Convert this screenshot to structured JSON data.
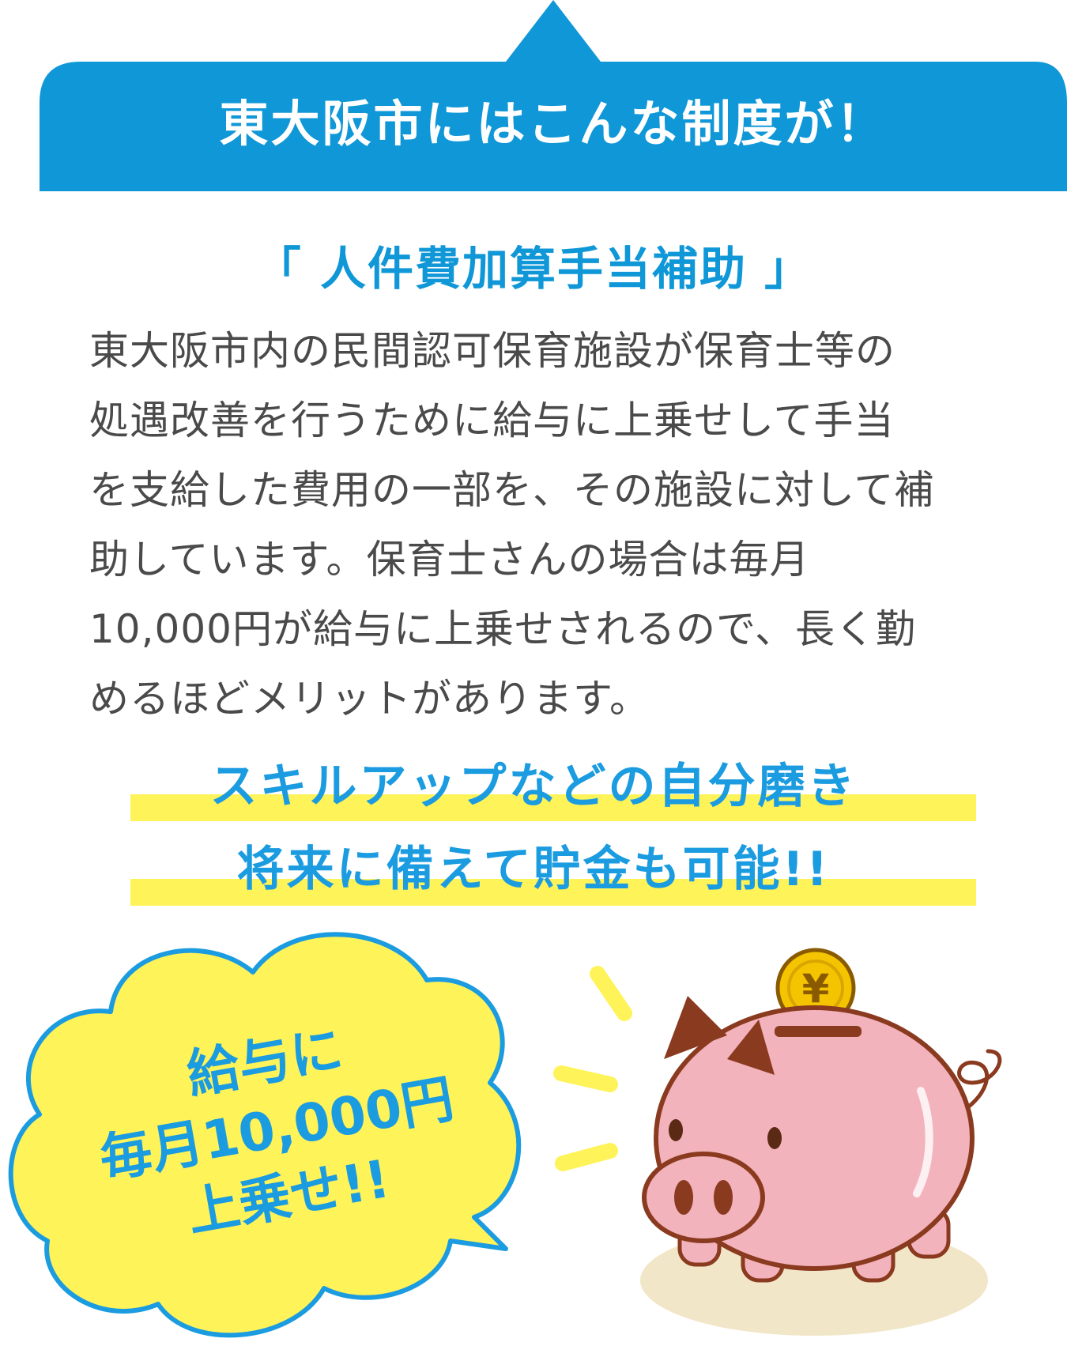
{
  "header": {
    "title": "東大阪市にはこんな制度が！"
  },
  "subsidy": {
    "title": "「 人件費加算手当補助 」"
  },
  "body": {
    "text": "東大阪市内の民間認可保育施設が保育士等の\n処遇改善を行うために給与に上乗せして手当\nを支給した費用の一部を、その施設に対して補\n助しています。保育士さんの場合は毎月\n10,000円が給与に上乗せされるので、長く勤\nめるほどメリットがあります。"
  },
  "highlights": [
    {
      "text": "スキルアップなどの自分磨き"
    },
    {
      "text": "将来に備えて貯金も可能!!"
    }
  ],
  "bubble": {
    "lines": [
      "給与に",
      "毎月10,000円",
      "上乗せ!!"
    ]
  },
  "piggy": {
    "coin_symbol": "¥"
  },
  "colors": {
    "header_blue": "#0f97d7",
    "text_blue": "#1b9be0",
    "yellow": "#fff35a",
    "pig_pink": "#f3b3bd",
    "body_text": "#4a4a4a"
  }
}
